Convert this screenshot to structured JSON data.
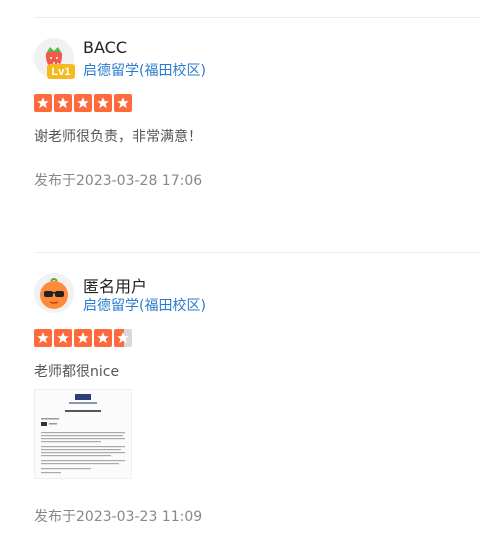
{
  "reviews": [
    {
      "username": "BACC",
      "level": "Lv1",
      "school": "启德留学(福田校区)",
      "rating": 5,
      "comment": "谢老师很负责，非常满意！",
      "date": "发布于2023-03-28 17:06",
      "avatar_icon": "strawberry-icon"
    },
    {
      "username": "匿名用户",
      "school": "启德留学(福田校区)",
      "rating": 4.5,
      "comment": "老师都很nice",
      "date": "发布于2023-03-23 11:09",
      "avatar_icon": "sunglasses-orange-icon",
      "attachment_icon": "document-thumbnail-icon"
    }
  ],
  "colors": {
    "star": "#ff6a3d",
    "star_empty": "#d9d9d9",
    "school_link": "#2a7bd1",
    "level_badge": "#f6b91e"
  }
}
